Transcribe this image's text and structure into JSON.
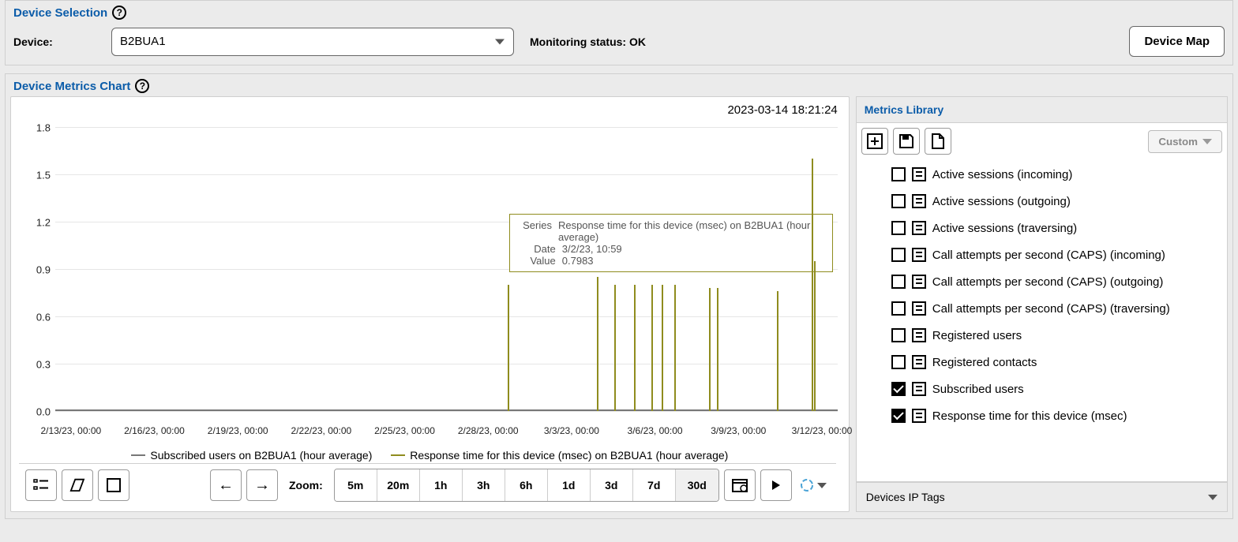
{
  "device_selection": {
    "title": "Device Selection",
    "label": "Device:",
    "value": "B2BUA1",
    "monitoring_status": "Monitoring status: OK",
    "device_map_btn": "Device Map"
  },
  "metrics_chart": {
    "title": "Device Metrics Chart",
    "timestamp": "2023-03-14 18:21:24"
  },
  "chart_data": {
    "type": "line",
    "title": "",
    "xlabel": "",
    "ylabel": "",
    "ylim": [
      0.0,
      1.8
    ],
    "y_ticks": [
      0.0,
      0.3,
      0.6,
      0.9,
      1.2,
      1.5,
      1.8
    ],
    "x_ticks": [
      "2/13/23, 00:00",
      "2/16/23, 00:00",
      "2/19/23, 00:00",
      "2/22/23, 00:00",
      "2/25/23, 00:00",
      "2/28/23, 00:00",
      "3/3/23, 00:00",
      "3/6/23, 00:00",
      "3/9/23, 00:00",
      "3/12/23, 00:00"
    ],
    "x_range_days": [
      0,
      30
    ],
    "series": [
      {
        "name": "Subscribed users on B2BUA1 (hour average)",
        "color": "#777777",
        "values_all_zero": true
      },
      {
        "name": "Response time for this device (msec) on B2BUA1 (hour average)",
        "color": "#8f8c1e",
        "spikes": [
          {
            "day_offset": 17.46,
            "value": 0.8
          },
          {
            "day_offset": 21.0,
            "value": 0.85
          },
          {
            "day_offset": 21.7,
            "value": 0.8
          },
          {
            "day_offset": 22.5,
            "value": 0.8
          },
          {
            "day_offset": 23.2,
            "value": 0.8
          },
          {
            "day_offset": 23.6,
            "value": 0.8
          },
          {
            "day_offset": 24.1,
            "value": 0.8
          },
          {
            "day_offset": 25.5,
            "value": 0.78
          },
          {
            "day_offset": 25.8,
            "value": 0.78
          },
          {
            "day_offset": 28.2,
            "value": 0.76
          },
          {
            "day_offset": 29.6,
            "value": 1.6
          },
          {
            "day_offset": 29.7,
            "value": 0.95
          }
        ]
      }
    ]
  },
  "tooltip": {
    "series_label": "Series",
    "series_value": "Response time for this device (msec) on B2BUA1 (hour average)",
    "date_label": "Date",
    "date_value": "3/2/23, 10:59",
    "value_label": "Value",
    "value_value": "0.7983"
  },
  "legend": {
    "item1": "Subscribed users on B2BUA1 (hour average)",
    "item2": "Response time for this device (msec) on B2BUA1 (hour average)"
  },
  "metrics_library": {
    "title": "Metrics Library",
    "custom_btn": "Custom",
    "items": [
      {
        "checked": false,
        "label": "Active sessions (incoming)"
      },
      {
        "checked": false,
        "label": "Active sessions (outgoing)"
      },
      {
        "checked": false,
        "label": "Active sessions (traversing)"
      },
      {
        "checked": false,
        "label": "Call attempts per second (CAPS) (incoming)"
      },
      {
        "checked": false,
        "label": "Call attempts per second (CAPS) (outgoing)"
      },
      {
        "checked": false,
        "label": "Call attempts per second (CAPS) (traversing)"
      },
      {
        "checked": false,
        "label": "Registered users"
      },
      {
        "checked": false,
        "label": "Registered contacts"
      },
      {
        "checked": true,
        "label": "Subscribed users"
      },
      {
        "checked": true,
        "label": "Response time for this device (msec)"
      }
    ],
    "footer": "Devices IP Tags"
  },
  "bottom_bar": {
    "zoom_label": "Zoom:",
    "zoom_levels": [
      "5m",
      "20m",
      "1h",
      "3h",
      "6h",
      "1d",
      "3d",
      "7d",
      "30d"
    ],
    "active_zoom": "30d"
  }
}
